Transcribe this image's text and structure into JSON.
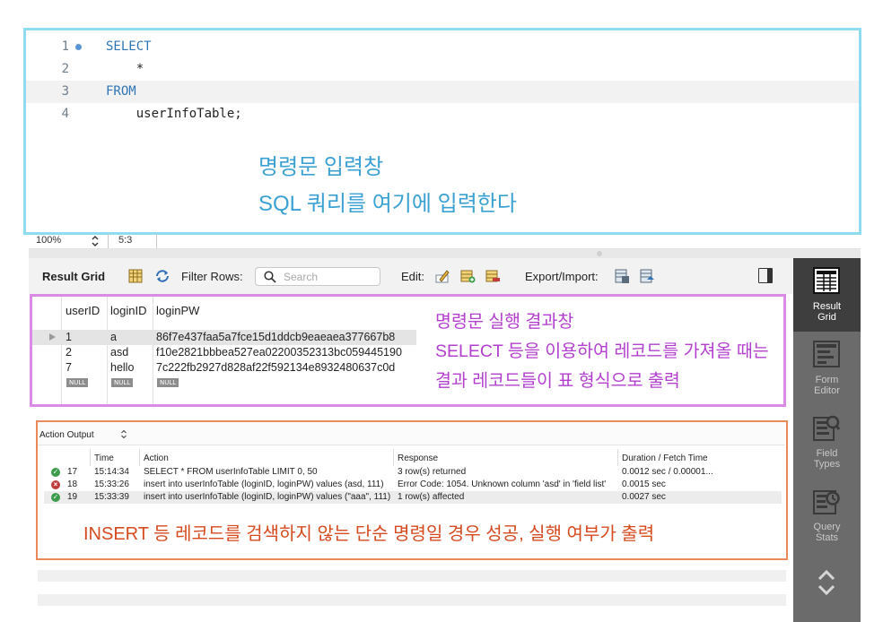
{
  "editor": {
    "lines": [
      {
        "number": "1",
        "text": "SELECT",
        "keyword": true,
        "marker": true
      },
      {
        "number": "2",
        "text": "    *",
        "keyword": false,
        "marker": false
      },
      {
        "number": "3",
        "text": "FROM",
        "keyword": true,
        "marker": false
      },
      {
        "number": "4",
        "text": "    userInfoTable;",
        "keyword": false,
        "marker": false
      }
    ],
    "annotation_line1": "명령문 입력창",
    "annotation_line2": "SQL 쿼리를 여기에 입력한다"
  },
  "status_bar": {
    "zoom": "100%",
    "cursor_position": "5:3"
  },
  "result_toolbar": {
    "title": "Result Grid",
    "filter_label": "Filter Rows:",
    "search_placeholder": "Search",
    "edit_label": "Edit:",
    "export_label": "Export/Import:"
  },
  "result_grid": {
    "columns": [
      "userID",
      "loginID",
      "loginPW"
    ],
    "rows": [
      {
        "userID": "1",
        "loginID": "a",
        "loginPW": "86f7e437faa5a7fce15d1ddcb9eaeaea377667b8",
        "selected": true
      },
      {
        "userID": "2",
        "loginID": "asd",
        "loginPW": "f10e2821bbbea527ea02200352313bc059445190",
        "selected": false
      },
      {
        "userID": "7",
        "loginID": "hello",
        "loginPW": "7c222fb2927d828af22f592134e8932480637c0d",
        "selected": false
      }
    ],
    "null_label": "NULL",
    "annotation_lines": [
      "명령문 실행 결과창",
      "SELECT 등을 이용하여 레코드를 가져올 때는",
      "결과 레코드들이 표 형식으로 출력"
    ]
  },
  "action_output": {
    "selector_label": "Action Output",
    "columns": [
      "Time",
      "Action",
      "Response",
      "Duration / Fetch Time"
    ],
    "rows": [
      {
        "status": "ok",
        "num": "17",
        "time": "15:14:34",
        "action": "SELECT     * FROM     userInfoTable LIMIT 0, 50",
        "response": "3 row(s) returned",
        "duration": "0.0012 sec / 0.00001..."
      },
      {
        "status": "error",
        "num": "18",
        "time": "15:33:26",
        "action": "insert into userInfoTable (loginID, loginPW) values (asd, 111)",
        "response": "Error Code: 1054. Unknown column 'asd' in 'field list'",
        "duration": "0.0015 sec"
      },
      {
        "status": "ok",
        "num": "19",
        "time": "15:33:39",
        "action": "insert into userInfoTable (loginID, loginPW) values (\"aaa\", 111)",
        "response": "1 row(s) affected",
        "duration": "0.0027 sec"
      }
    ],
    "annotation": "INSERT 등 레코드를 검색하지 않는 단순 명령일 경우 성공, 실행 여부가 출력"
  },
  "sidebar": {
    "items": [
      {
        "label_line1": "Result",
        "label_line2": "Grid",
        "icon": "result-grid-icon",
        "active": true
      },
      {
        "label_line1": "Form",
        "label_line2": "Editor",
        "icon": "form-editor-icon",
        "active": false
      },
      {
        "label_line1": "Field",
        "label_line2": "Types",
        "icon": "field-types-icon",
        "active": false
      },
      {
        "label_line1": "Query",
        "label_line2": "Stats",
        "icon": "query-stats-icon",
        "active": false
      }
    ]
  },
  "colors": {
    "editor_frame": "#8fdcf0",
    "editor_annotation": "#3aa1d2",
    "grid_frame": "#d98be6",
    "grid_annotation": "#b33fce",
    "output_frame": "#ea8a5c",
    "output_annotation": "#d64a1f",
    "keyword": "#2f75b5"
  }
}
